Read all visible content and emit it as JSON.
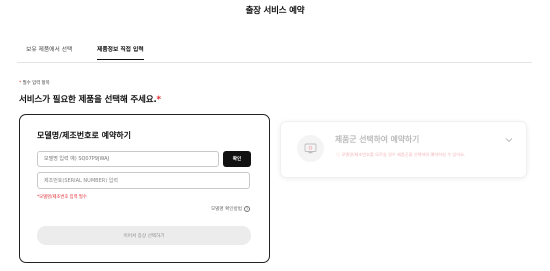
{
  "header": {
    "title": "출장 서비스 예약"
  },
  "tabs": [
    {
      "label": "보유 제품에서 선택"
    },
    {
      "label": "제품정보 직접 입력"
    }
  ],
  "required_note": {
    "star": "*",
    "text": "필수 입력 항목"
  },
  "section": {
    "heading": "서비스가 필요한 제품을 선택해 주세요.",
    "star": "*"
  },
  "model_card": {
    "title": "모델명/제조번호로 예약하기",
    "model_input": {
      "value": "",
      "placeholder": "모델명 입력 예) SQ07P9JWAJ"
    },
    "confirm_label": "확인",
    "serial_input": {
      "value": "",
      "placeholder": "제조번호(SERIAL NUMBER) 입력"
    },
    "error_text": "*모델명/제조번호 입력 필수",
    "help_link": "모델명 확인방법",
    "help_icon": "?",
    "submit_label": "이어서 증상 선택하기"
  },
  "category_card": {
    "title": "제품군 선택하여 예약하기",
    "note": "ⓘ 모델명/제조번호를 모르실 경우 제품군을 선택하여 예약하실 수 있어요."
  },
  "colors": {
    "accent_red": "#e0262e",
    "primary_black": "#111111",
    "disabled_gray": "#ececec"
  }
}
